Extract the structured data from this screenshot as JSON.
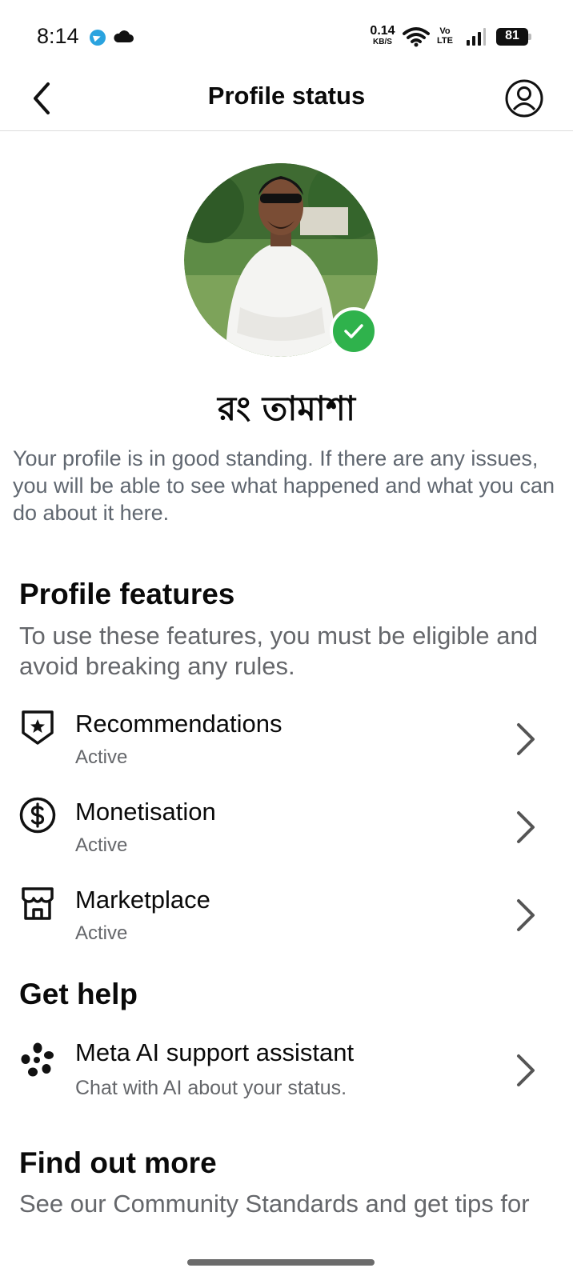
{
  "status_bar": {
    "time": "8:14",
    "net_speed_value": "0.14",
    "net_speed_unit": "KB/S",
    "volte_top": "Vo",
    "volte_bottom": "LTE",
    "battery": "81"
  },
  "header": {
    "title": "Profile status"
  },
  "profile": {
    "name": "রং তামাশা",
    "standing_text": "Your profile is in good standing. If there are any issues, you will be able to see what happened and what you can do about it here.",
    "verified_color": "#2fb24c"
  },
  "profile_features": {
    "title": "Profile features",
    "subtitle": "To use these features, you must be eligible and avoid breaking any rules.",
    "items": [
      {
        "label": "Recommendations",
        "status": "Active",
        "icon": "shield-star-icon"
      },
      {
        "label": "Monetisation",
        "status": "Active",
        "icon": "dollar-circle-icon"
      },
      {
        "label": "Marketplace",
        "status": "Active",
        "icon": "storefront-icon"
      }
    ]
  },
  "get_help": {
    "title": "Get help",
    "items": [
      {
        "label": "Meta AI support assistant",
        "subtitle": "Chat with AI about your status.",
        "icon": "meta-ai-icon"
      }
    ]
  },
  "find_out_more": {
    "title": "Find out more",
    "subtitle": "See our Community Standards and get tips for"
  }
}
